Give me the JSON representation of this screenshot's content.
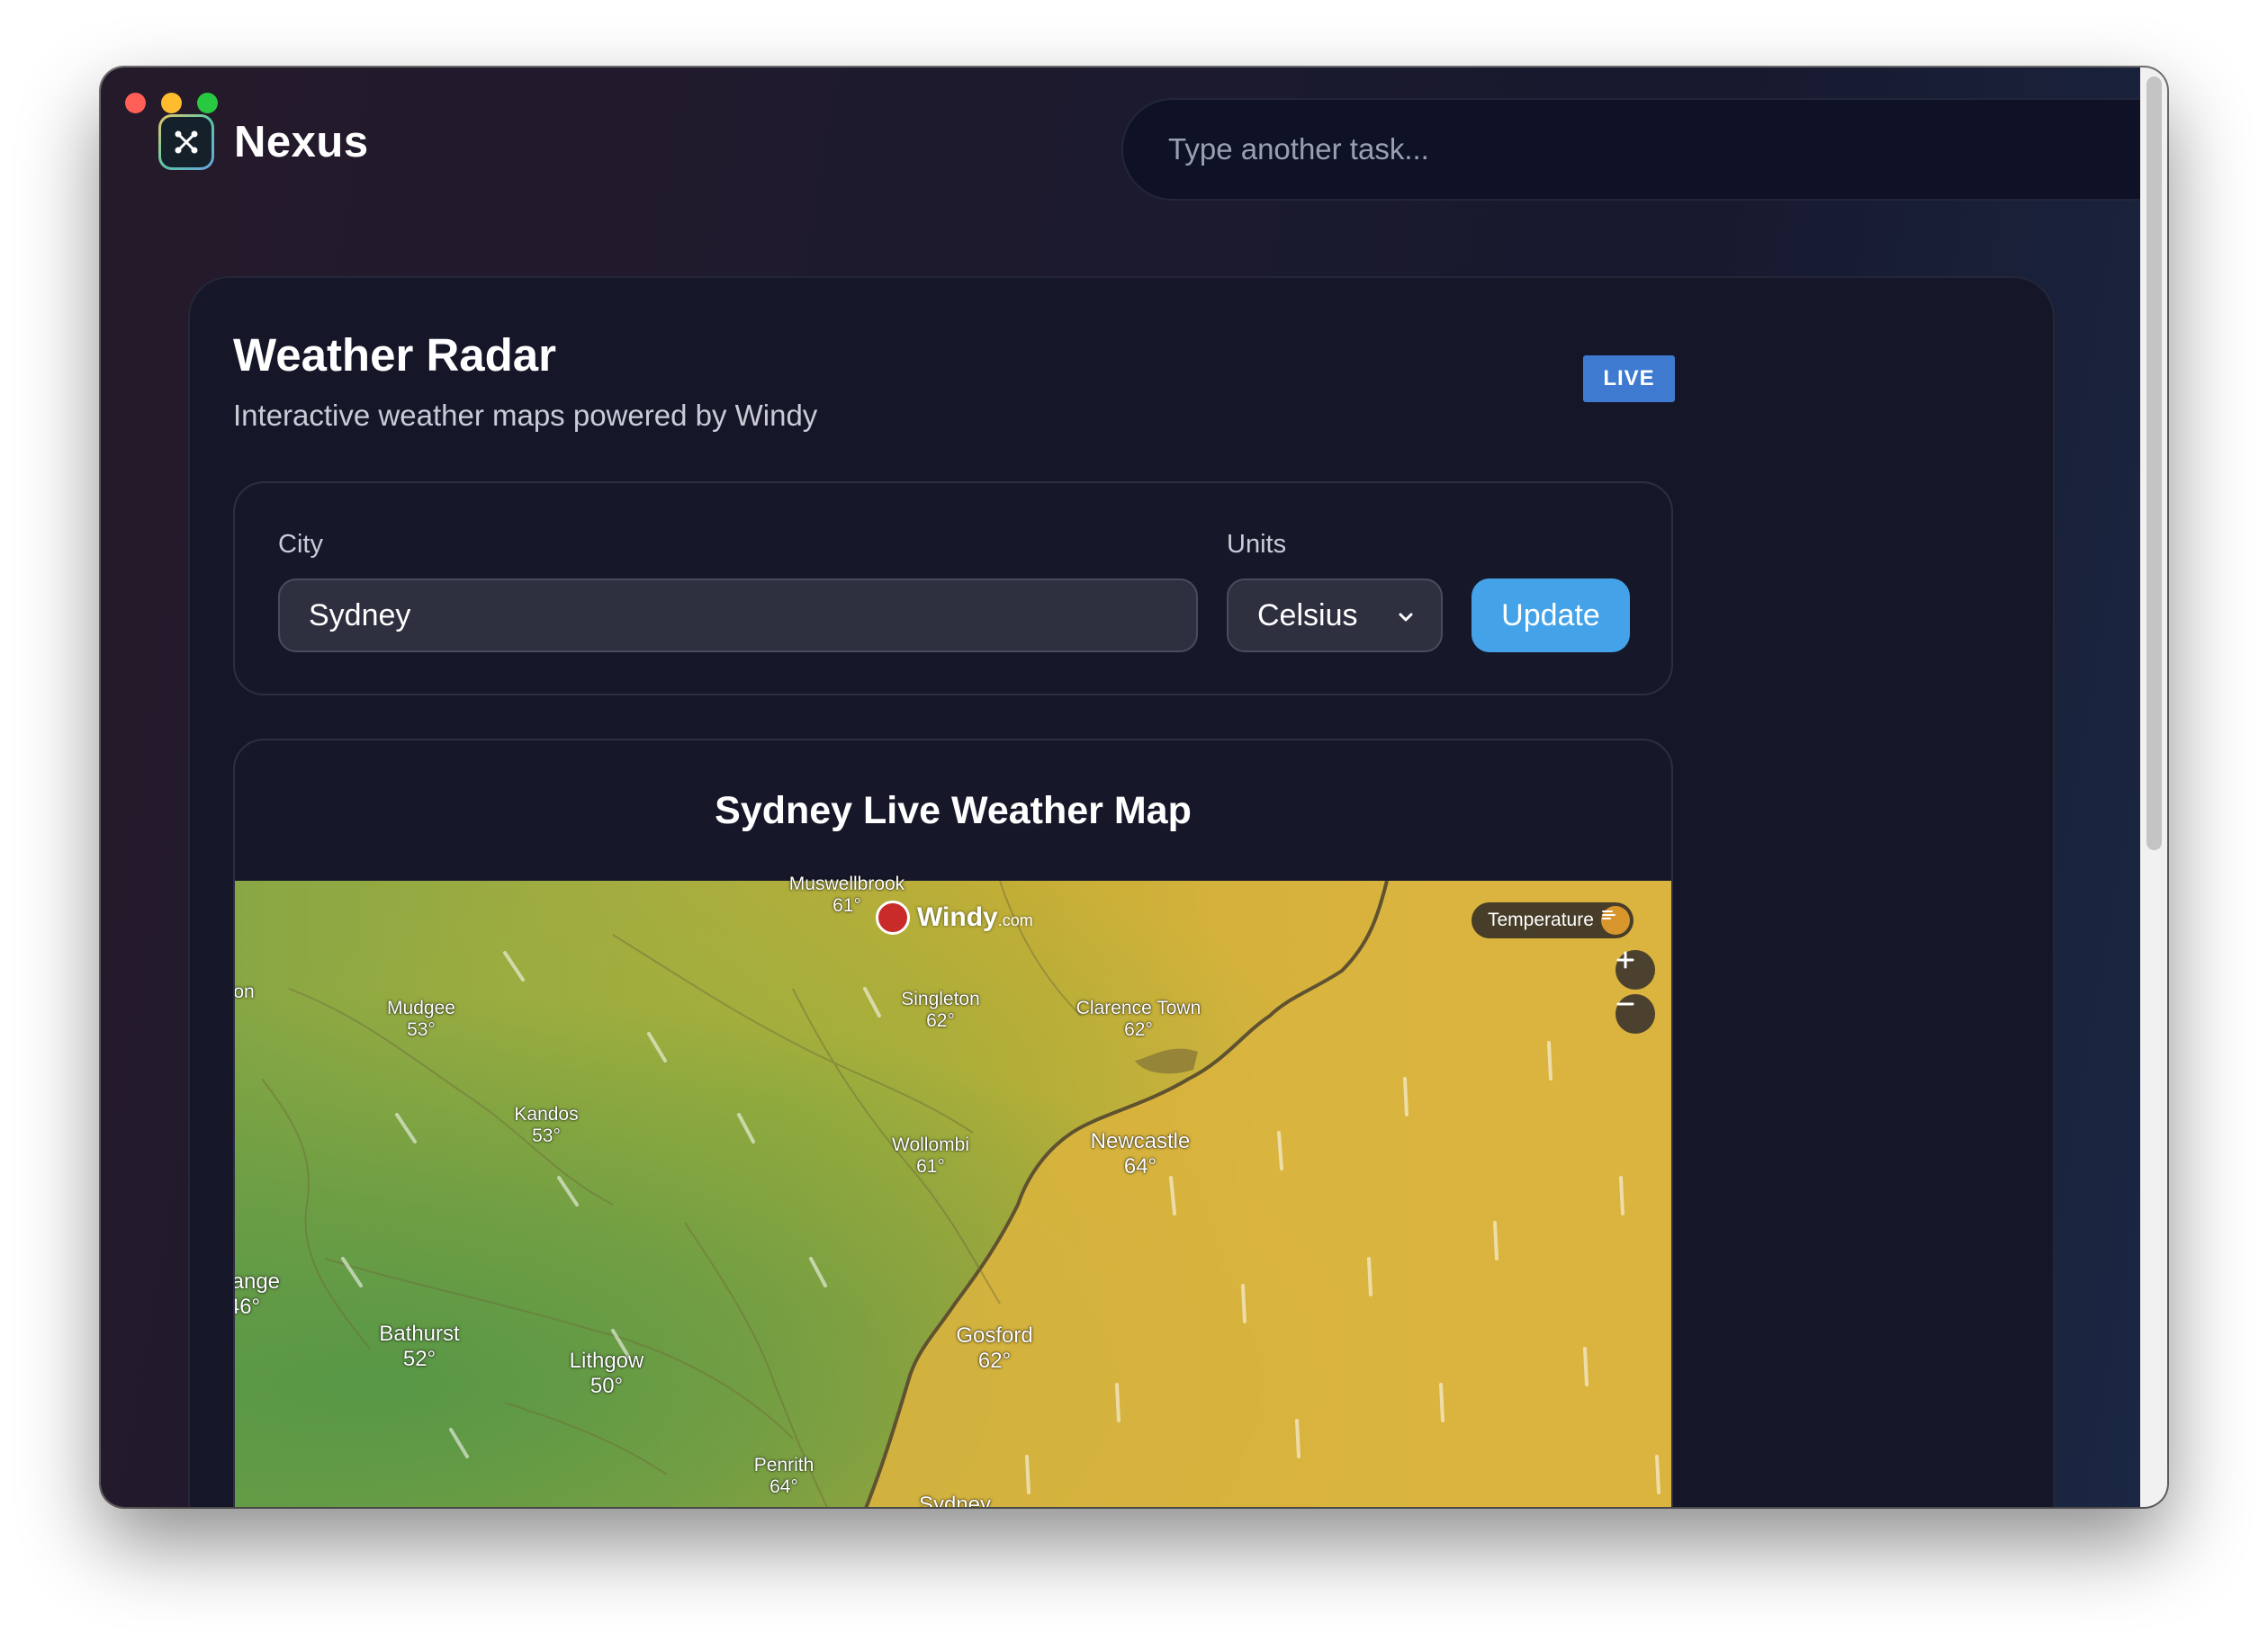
{
  "app": {
    "name": "Nexus"
  },
  "task_bar": {
    "placeholder": "Type another task..."
  },
  "card": {
    "title": "Weather Radar",
    "subtitle": "Interactive weather maps powered by Windy",
    "badge": "LIVE"
  },
  "form": {
    "city_label": "City",
    "city_value": "Sydney",
    "units_label": "Units",
    "units_value": "Celsius",
    "update_label": "Update"
  },
  "map": {
    "title": "Sydney Live Weather Map",
    "provider": {
      "name": "Windy",
      "suffix": ".com"
    },
    "layer_label": "Temperature",
    "places": [
      {
        "name": "Muswellbrook",
        "temp": "61°"
      },
      {
        "name": "Mudgee",
        "temp": "53°"
      },
      {
        "name": "Singleton",
        "temp": "62°"
      },
      {
        "name": "Clarence Town",
        "temp": "62°"
      },
      {
        "name": "Kandos",
        "temp": "53°"
      },
      {
        "name": "Wollombi",
        "temp": "61°"
      },
      {
        "name": "Newcastle",
        "temp": "64°"
      },
      {
        "name": "Orange",
        "temp": "46°"
      },
      {
        "name": "Bathurst",
        "temp": "52°"
      },
      {
        "name": "Lithgow",
        "temp": "50°"
      },
      {
        "name": "Gosford",
        "temp": "62°"
      },
      {
        "name": "Penrith",
        "temp": "64°"
      },
      {
        "name": "Sydney",
        "temp": ""
      },
      {
        "name": "on",
        "temp": ""
      }
    ]
  },
  "colors": {
    "accent_button": "#44a3e8",
    "badge": "#3f7ad1",
    "card_bg": "#151628"
  }
}
